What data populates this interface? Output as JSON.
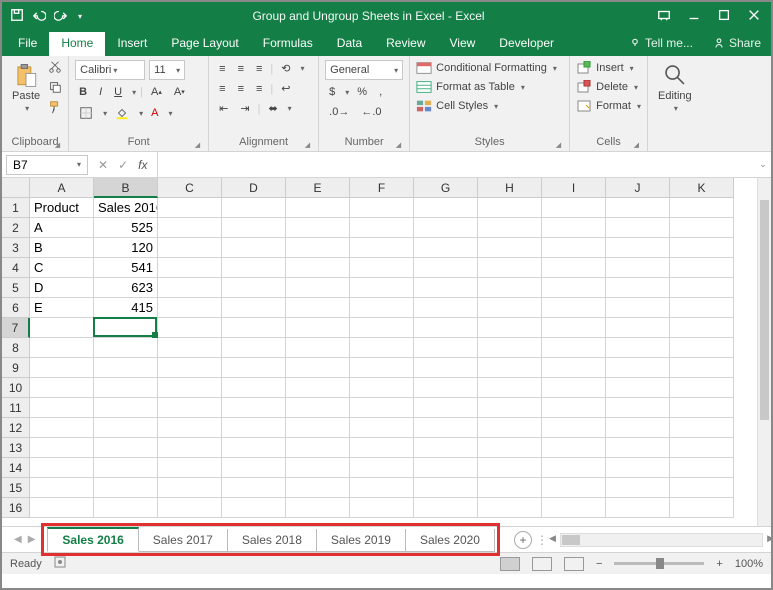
{
  "window": {
    "title": "Group and Ungroup Sheets in Excel - Excel"
  },
  "ribbon_tabs": [
    "File",
    "Home",
    "Insert",
    "Page Layout",
    "Formulas",
    "Data",
    "Review",
    "View",
    "Developer"
  ],
  "tell_me": "Tell me...",
  "share": "Share",
  "font": {
    "name": "Calibri",
    "size": "11"
  },
  "number_format": "General",
  "groups": {
    "clipboard": "Clipboard",
    "font": "Font",
    "alignment": "Alignment",
    "number": "Number",
    "styles": "Styles",
    "cells": "Cells",
    "editing": "Editing"
  },
  "paste_label": "Paste",
  "styles": {
    "cond": "Conditional Formatting",
    "table": "Format as Table",
    "cell": "Cell Styles"
  },
  "cells": {
    "insert": "Insert",
    "delete": "Delete",
    "format": "Format"
  },
  "editing_label": "Editing",
  "namebox": "B7",
  "columns": [
    "A",
    "B",
    "C",
    "D",
    "E",
    "F",
    "G",
    "H",
    "I",
    "J",
    "K"
  ],
  "rows": 16,
  "active": {
    "row": 7,
    "col": 2
  },
  "grid": {
    "A1": "Product",
    "B1": "Sales 2016",
    "A2": "A",
    "B2": "525",
    "A3": "B",
    "B3": "120",
    "A4": "C",
    "B4": "541",
    "A5": "D",
    "B5": "623",
    "A6": "E",
    "B6": "415"
  },
  "sheet_tabs": [
    "Sales 2016",
    "Sales 2017",
    "Sales 2018",
    "Sales 2019",
    "Sales 2020"
  ],
  "active_sheet": 0,
  "status": {
    "ready": "Ready",
    "zoom": "100%"
  },
  "chart_data": {
    "type": "table",
    "title": "Sales 2016",
    "columns": [
      "Product",
      "Sales 2016"
    ],
    "rows": [
      [
        "A",
        525
      ],
      [
        "B",
        120
      ],
      [
        "C",
        541
      ],
      [
        "D",
        623
      ],
      [
        "E",
        415
      ]
    ]
  }
}
